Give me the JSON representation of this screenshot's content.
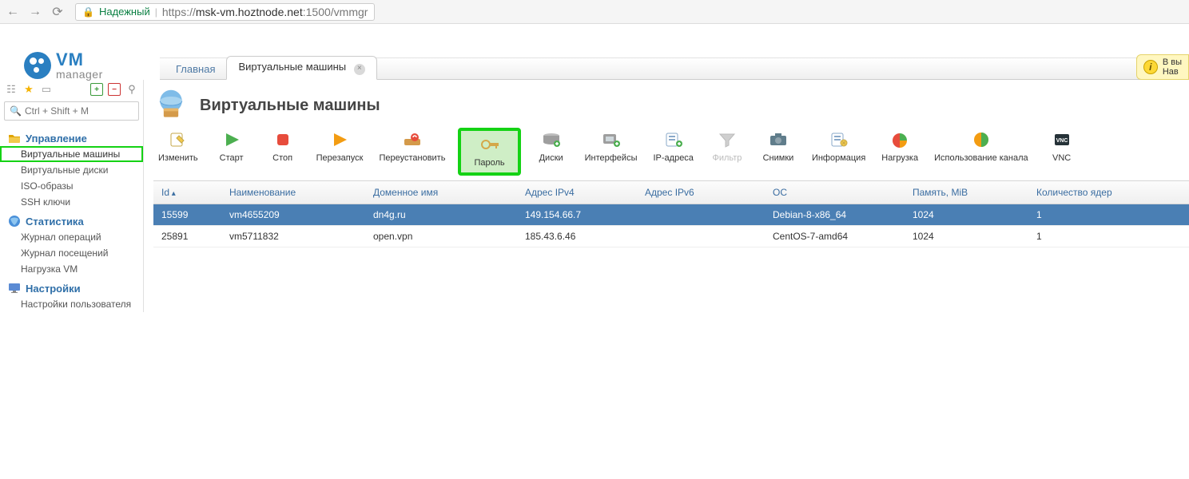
{
  "browser": {
    "secure_label": "Надежный",
    "url_prefix": "https://",
    "url_host": "msk-vm.hoztnode.net",
    "url_port_path": ":1500/vmmgr"
  },
  "logo": {
    "line1": "VM",
    "line2": "manager"
  },
  "tabs": [
    {
      "label": "Главная",
      "active": false
    },
    {
      "label": "Виртуальные машины",
      "active": true
    }
  ],
  "info_box": {
    "line1": "В вы",
    "line2": "Нав"
  },
  "search_placeholder": "Ctrl + Shift + M",
  "sidebar": {
    "sections": [
      {
        "title": "Управление",
        "items": [
          "Виртуальные машины",
          "Виртуальные диски",
          "ISO-образы",
          "SSH ключи"
        ]
      },
      {
        "title": "Статистика",
        "items": [
          "Журнал операций",
          "Журнал посещений",
          "Нагрузка VM"
        ]
      },
      {
        "title": "Настройки",
        "items": [
          "Настройки пользователя"
        ]
      }
    ]
  },
  "page": {
    "title": "Виртуальные машины"
  },
  "toolbar": [
    {
      "id": "edit",
      "label": "Изменить"
    },
    {
      "id": "start",
      "label": "Старт"
    },
    {
      "id": "stop",
      "label": "Стоп"
    },
    {
      "id": "restart",
      "label": "Перезапуск"
    },
    {
      "id": "reinstall",
      "label": "Переустановить"
    },
    {
      "id": "password",
      "label": "Пароль",
      "highlighted": true
    },
    {
      "id": "disks",
      "label": "Диски"
    },
    {
      "id": "interfaces",
      "label": "Интерфейсы"
    },
    {
      "id": "ip",
      "label": "IP-адреса"
    },
    {
      "id": "filter",
      "label": "Фильтр",
      "disabled": true
    },
    {
      "id": "snapshots",
      "label": "Снимки"
    },
    {
      "id": "info",
      "label": "Информация"
    },
    {
      "id": "load",
      "label": "Нагрузка"
    },
    {
      "id": "bandwidth",
      "label": "Использование канала"
    },
    {
      "id": "vnc",
      "label": "VNC"
    }
  ],
  "table": {
    "columns": [
      "Id",
      "Наименование",
      "Доменное имя",
      "Адрес IPv4",
      "Адрес IPv6",
      "ОС",
      "Память, MiB",
      "Количество ядер"
    ],
    "rows": [
      {
        "selected": true,
        "cells": [
          "15599",
          "vm4655209",
          "dn4g.ru",
          "149.154.66.7",
          "",
          "Debian-8-x86_64",
          "1024",
          "1"
        ]
      },
      {
        "selected": false,
        "cells": [
          "25891",
          "vm5711832",
          "open.vpn",
          "185.43.6.46",
          "",
          "CentOS-7-amd64",
          "1024",
          "1"
        ]
      }
    ]
  }
}
